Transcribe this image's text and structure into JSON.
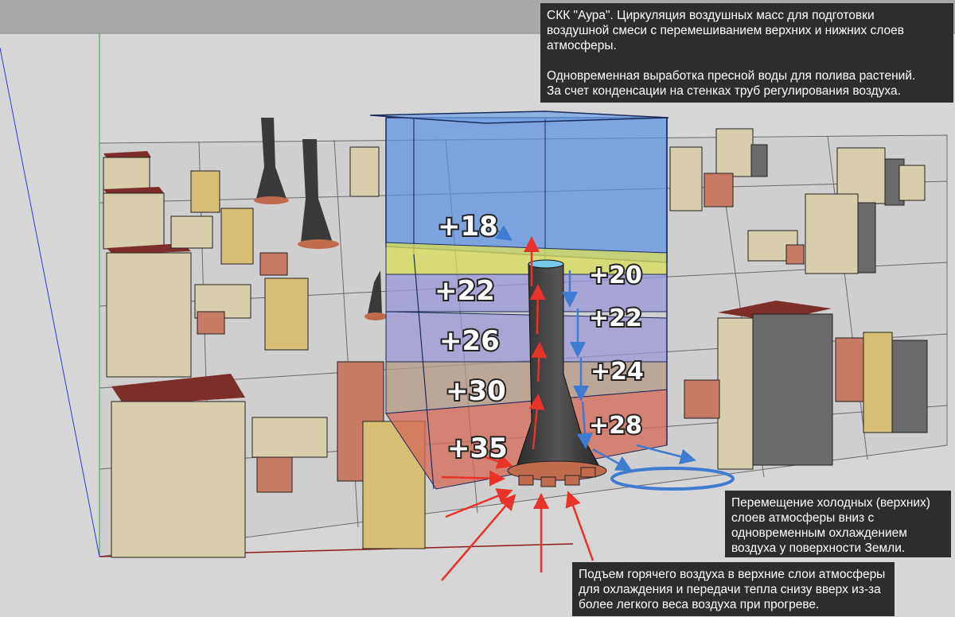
{
  "annotations": {
    "top_line1": "СКК \"Аура\". Циркуляция воздушных масс для подготовки",
    "top_line2": "воздушной смеси с перемешиванием верхних и нижних слоев",
    "top_line3": "атмосферы.",
    "top_line4": "Одновременная выработка пресной воды для полива растений.",
    "top_line5": "За счет конденсации на стенках труб регулирования воздуха.",
    "right_line1": "Перемещение холодных (верхних)",
    "right_line2": "слоев атмосферы вниз с",
    "right_line3": "одновременным охлаждением",
    "right_line4": "воздуха у поверхности Земли.",
    "bottom_line1": "Подъем горячего воздуха в верхние слои атмосферы",
    "bottom_line2": "для охлаждения и передачи тепла снизу вверх из-за",
    "bottom_line3": "более легкого веса воздуха при прогреве."
  },
  "left_column_labels": [
    "+18",
    "+22",
    "+26",
    "+30",
    "+35"
  ],
  "right_column_labels": [
    "+20",
    "+22",
    "+24",
    "+28"
  ],
  "colors": {
    "sky": "#a9a9a9",
    "ground": "#d4d4d4",
    "building_top": "#7e2e28",
    "building_front": "#d8ceab",
    "warm_arrow": "#e8322a",
    "cool_arrow": "#3d7cd0",
    "layer_top": "#5b92e3",
    "layer_yellow": "#d8de5c",
    "layer_purple": "#9a96d8",
    "layer_brown": "#b59a86",
    "layer_red": "#d46b5a",
    "tower": "#3b3b3b",
    "note_bg": "#2d2d2d"
  }
}
